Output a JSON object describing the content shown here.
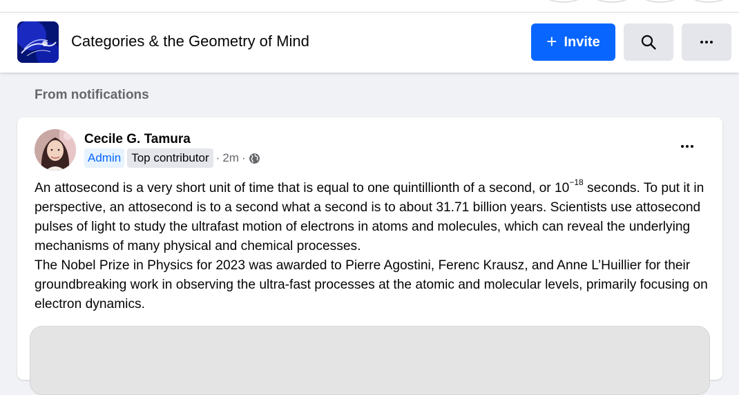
{
  "group": {
    "title": "Categories & the Geometry of Mind",
    "invite_label": "Invite",
    "search_icon": "search-icon",
    "more_icon": "more-options-icon"
  },
  "feed": {
    "section_label": "From notifications"
  },
  "post": {
    "author": "Cecile G. Tamura",
    "badge_admin": "Admin",
    "badge_top": "Top contributor",
    "time": "2m",
    "privacy_icon": "globe-icon",
    "p1_before": "An attosecond is a very short unit of time that is equal to one quintillionth of a second, or 10",
    "p1_sup": "−18",
    "p1_after": " seconds. To put it in perspective, an attosecond is to a second what a second is to about 31.71 billion years. Scientists use attosecond pulses of light to study the ultrafast motion of electrons in atoms and molecules, which can reveal the underlying mechanisms of many physical and chemical processes.",
    "p2": "The Nobel Prize in Physics for 2023 was awarded to Pierre Agostini, Ferenc Krausz, and Anne L’Huillier for their groundbreaking work in observing the ultra-fast processes at the atomic and molecular levels, primarily focusing on electron dynamics."
  },
  "colors": {
    "accent": "#0866ff",
    "background": "#f0f2f5",
    "secondary_text": "#65676b"
  }
}
